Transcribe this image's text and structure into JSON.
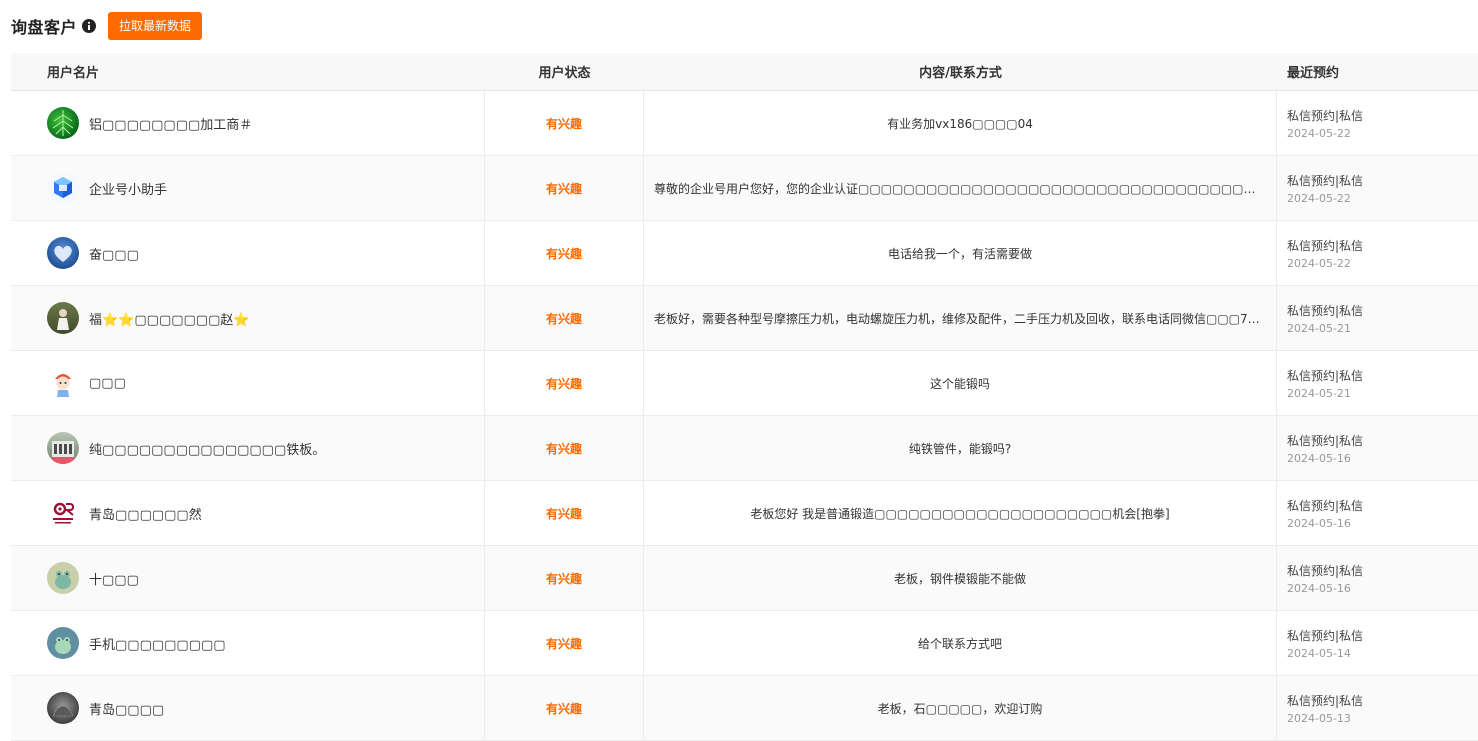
{
  "header": {
    "title": "询盘客户",
    "fetch_button": "拉取最新数据"
  },
  "columns": {
    "user": "用户名片",
    "status": "用户状态",
    "content": "内容/联系方式",
    "recent": "最近预约"
  },
  "colors": {
    "accent": "#ff6a00"
  },
  "rows": [
    {
      "name": "铝▢▢▢▢▢▢▢▢加工商＃",
      "status": "有兴趣",
      "content": "有业务加vx186▢▢▢▢04",
      "recent_type": "私信预约|私信",
      "recent_date": "2024-05-22",
      "avatar": "green-leaf-avatar"
    },
    {
      "name": "企业号小助手",
      "status": "有兴趣",
      "content": "尊敬的企业号用户您好，您的企业认证▢▢▢▢▢▢▢▢▢▢▢▢▢▢▢▢▢▢▢▢▢▢▢▢▢▢▢▢▢▢▢▢▢▢▢▢▢▢▢▢▢▢▢全...",
      "recent_type": "私信预约|私信",
      "recent_date": "2024-05-22",
      "avatar": "blue-cube-avatar"
    },
    {
      "name": "奋▢▢▢",
      "status": "有兴趣",
      "content": "电话给我一个，有活需要做",
      "recent_type": "私信预约|私信",
      "recent_date": "2024-05-22",
      "avatar": "heart-avatar"
    },
    {
      "name": "福⭐⭐▢▢▢▢▢▢▢赵⭐",
      "status": "有兴趣",
      "content": "老板好，需要各种型号摩擦压力机，电动螺旋压力机，维修及配件，二手压力机及回收，联系电话同微信▢▢▢77...",
      "recent_type": "私信预约|私信",
      "recent_date": "2024-05-21",
      "avatar": "person-outdoor-avatar"
    },
    {
      "name": "▢▢▢",
      "status": "有兴趣",
      "content": "这个能锻吗",
      "recent_type": "私信预约|私信",
      "recent_date": "2024-05-21",
      "avatar": "cartoon-girl-avatar"
    },
    {
      "name": "纯▢▢▢▢▢▢▢▢▢▢▢▢▢▢▢铁板。",
      "status": "有兴趣",
      "content": "纯铁管件，能锻吗?",
      "recent_type": "私信预约|私信",
      "recent_date": "2024-05-16",
      "avatar": "building-avatar"
    },
    {
      "name": "青岛▢▢▢▢▢▢然",
      "status": "有兴趣",
      "content": "老板您好 我是普通锻造▢▢▢▢▢▢▢▢▢▢▢▢▢▢▢▢▢▢▢▢▢机会[抱拳]",
      "recent_type": "私信预约|私信",
      "recent_date": "2024-05-16",
      "avatar": "logo-avatar"
    },
    {
      "name": "十▢▢▢",
      "status": "有兴趣",
      "content": "老板，钢件模锻能不能做",
      "recent_type": "私信预约|私信",
      "recent_date": "2024-05-16",
      "avatar": "cartoon-frog-avatar"
    },
    {
      "name": "手机▢▢▢▢▢▢▢▢▢",
      "status": "有兴趣",
      "content": "给个联系方式吧",
      "recent_type": "私信预约|私信",
      "recent_date": "2024-05-14",
      "avatar": "cartoon-frog-avatar-2"
    },
    {
      "name": "青岛▢▢▢▢",
      "status": "有兴趣",
      "content": "老板，石▢▢▢▢▢，欢迎订购",
      "recent_type": "私信预约|私信",
      "recent_date": "2024-05-13",
      "avatar": "hedgehog-avatar"
    }
  ]
}
